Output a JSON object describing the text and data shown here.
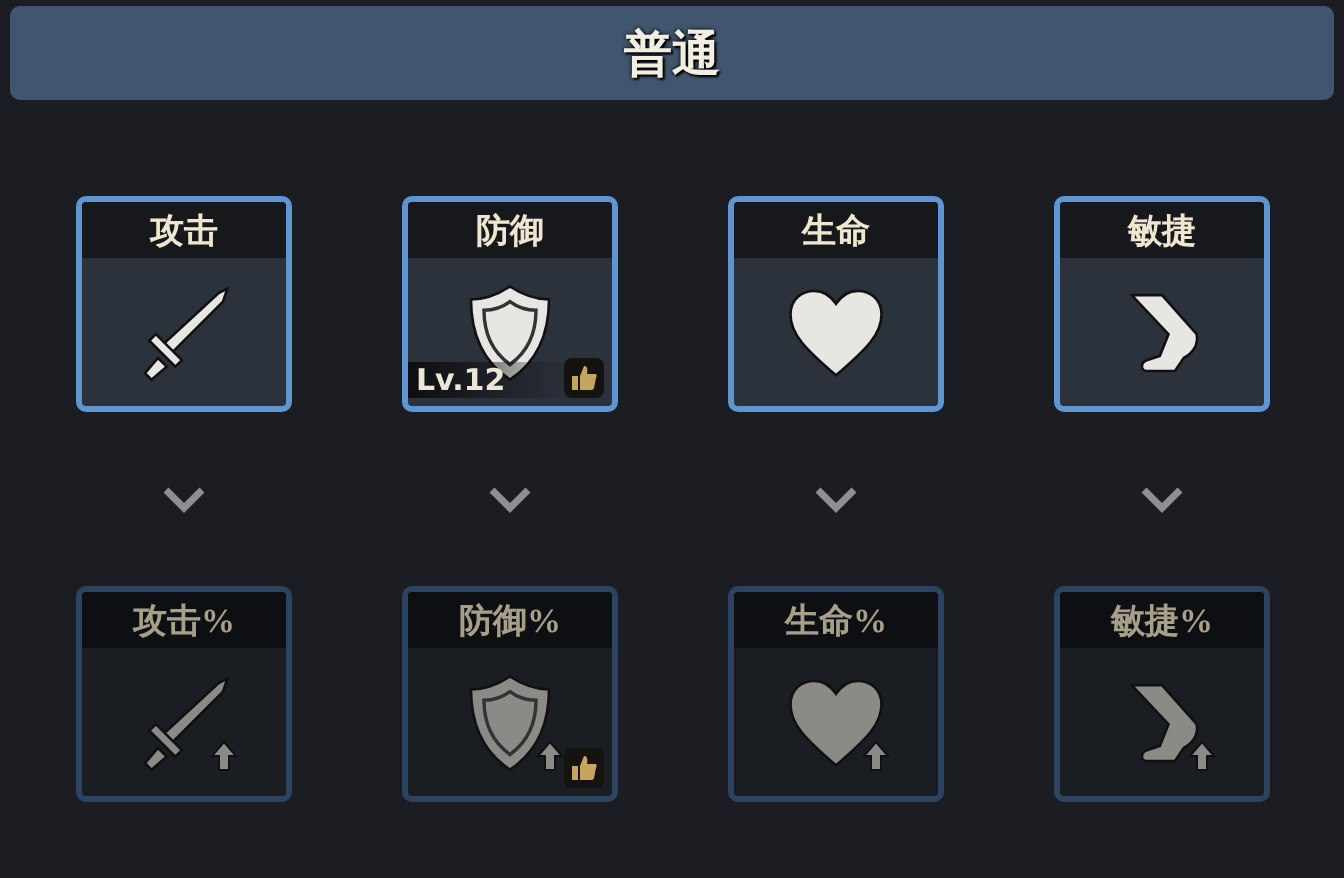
{
  "header": {
    "title": "普通"
  },
  "rows": [
    {
      "cards": [
        {
          "label": "攻击",
          "kind": "sword",
          "active": true,
          "boost": false,
          "recommended": false
        },
        {
          "label": "防御",
          "kind": "shield",
          "active": true,
          "boost": false,
          "recommended": true,
          "level_text": "Lv.12"
        },
        {
          "label": "生命",
          "kind": "heart",
          "active": true,
          "boost": false,
          "recommended": false
        },
        {
          "label": "敏捷",
          "kind": "foot",
          "active": true,
          "boost": false,
          "recommended": false
        }
      ]
    },
    {
      "cards": [
        {
          "label": "攻击%",
          "kind": "sword",
          "active": false,
          "boost": true,
          "recommended": false
        },
        {
          "label": "防御%",
          "kind": "shield",
          "active": false,
          "boost": true,
          "recommended": true
        },
        {
          "label": "生命%",
          "kind": "heart",
          "active": false,
          "boost": true,
          "recommended": false
        },
        {
          "label": "敏捷%",
          "kind": "foot",
          "active": false,
          "boost": true,
          "recommended": false
        }
      ]
    }
  ]
}
